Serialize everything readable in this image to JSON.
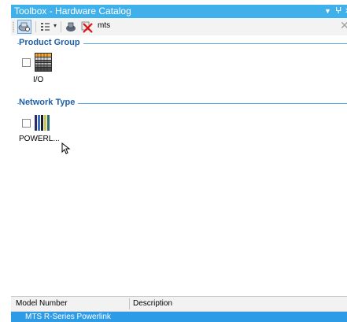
{
  "window": {
    "title": "Toolbox - Hardware Catalog",
    "pin_glyph": "▾ ⊥ ×"
  },
  "toolbar": {
    "search_text": "mts",
    "clear_glyph": "✕"
  },
  "groups": {
    "product_group": {
      "label": "Product Group",
      "items": [
        {
          "label": "I/O",
          "checked": false,
          "icon": "io-module-icon"
        }
      ]
    },
    "network_type": {
      "label": "Network Type",
      "items": [
        {
          "label": "POWERL...",
          "checked": false,
          "icon": "powerlink-icon"
        }
      ]
    }
  },
  "grid": {
    "columns": [
      "Model Number",
      "Description"
    ],
    "rows": [
      {
        "text": "MTS R-Series Powerlink",
        "selected": true
      }
    ]
  },
  "colors": {
    "titlebar": "#3fb0ea",
    "group_header": "#1e5fa8",
    "selection": "#2e9be6"
  }
}
